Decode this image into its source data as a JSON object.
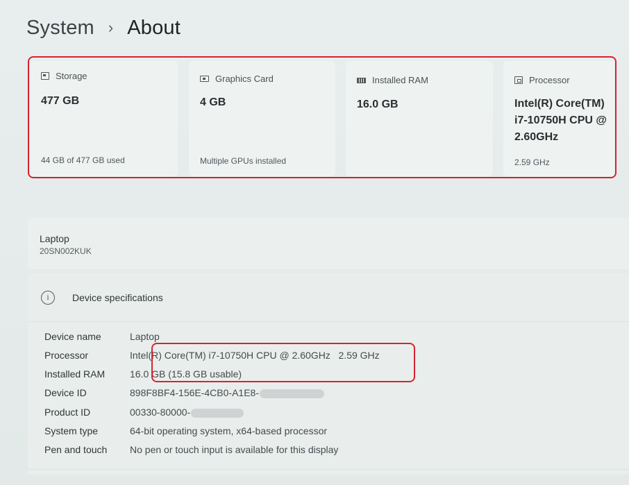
{
  "breadcrumb": {
    "parent": "System",
    "separator": "›",
    "current": "About"
  },
  "cards": [
    {
      "icon": "storage-icon",
      "label": "Storage",
      "value": "477 GB",
      "footer": "44 GB of 477 GB used"
    },
    {
      "icon": "graphics-card-icon",
      "label": "Graphics Card",
      "value": "4 GB",
      "footer": "Multiple GPUs installed"
    },
    {
      "icon": "ram-icon",
      "label": "Installed RAM",
      "value": "16.0 GB",
      "footer": ""
    },
    {
      "icon": "processor-icon",
      "label": "Processor",
      "value_lines": [
        "Intel(R) Core(TM)",
        "i7-10750H CPU @",
        "2.60GHz"
      ],
      "footer": "2.59 GHz"
    }
  ],
  "device": {
    "name": "Laptop",
    "model": "20SN002KUK"
  },
  "specs": {
    "title": "Device specifications",
    "info_icon_glyph": "i",
    "rows": [
      {
        "label": "Device name",
        "value": "Laptop"
      },
      {
        "label": "Processor",
        "value": "Intel(R) Core(TM) i7-10750H CPU @ 2.60GHz   2.59 GHz"
      },
      {
        "label": "Installed RAM",
        "value": "16.0 GB (15.8 GB usable)"
      },
      {
        "label": "Device ID",
        "value": "898F8BF4-156E-4CB0-A1E8-"
      },
      {
        "label": "Product ID",
        "value": "00330-80000-"
      },
      {
        "label": "System type",
        "value": "64-bit operating system, x64-based processor"
      },
      {
        "label": "Pen and touch",
        "value": "No pen or touch input is available for this display"
      }
    ]
  },
  "colors": {
    "highlight": "#d6222f",
    "background": "#e4ebea",
    "card": "#eef3f2"
  }
}
